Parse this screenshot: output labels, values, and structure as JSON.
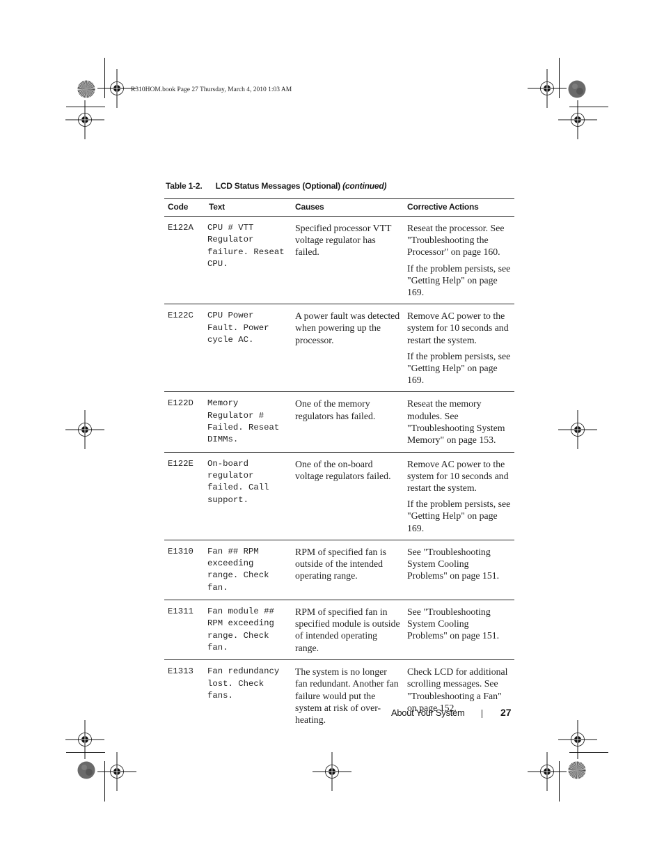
{
  "slug": "R310HOM.book  Page 27  Thursday, March 4, 2010  1:03 AM",
  "table": {
    "number": "Table 1-2.",
    "title": "LCD Status Messages (Optional)",
    "continued": "(continued)",
    "headers": [
      "Code",
      "Text",
      "Causes",
      "Corrective Actions"
    ],
    "rows": [
      {
        "code": "E122A",
        "text": "CPU # VTT Regulator failure. Reseat CPU.",
        "causes": "Specified processor VTT voltage regulator has failed.",
        "actions": [
          "Reseat the processor. See \"Troubleshooting the Processor\" on page 160.",
          "If the problem persists, see \"Getting Help\" on page 169."
        ]
      },
      {
        "code": "E122C",
        "text": "CPU Power Fault. Power cycle AC.",
        "causes": "A power fault was detected when powering up the processor.",
        "actions": [
          "Remove AC power to the system for 10 seconds and restart the system.",
          "If the problem persists, see \"Getting Help\" on page 169."
        ]
      },
      {
        "code": "E122D",
        "text": "Memory Regulator # Failed. Reseat DIMMs.",
        "causes": "One of the memory regulators has failed.",
        "actions": [
          "Reseat the memory modules. See \"Troubleshooting System Memory\" on page 153."
        ]
      },
      {
        "code": "E122E",
        "text": "On-board regulator failed. Call support.",
        "causes": "One of the on-board voltage regulators failed.",
        "actions": [
          "Remove AC power to the system for 10 seconds and restart the system.",
          "If the problem persists, see \"Getting Help\" on page 169."
        ]
      },
      {
        "code": "E1310",
        "text": "Fan ## RPM exceeding range. Check fan.",
        "causes": "RPM of specified fan is outside of the intended operating range.",
        "actions": [
          "See \"Troubleshooting System Cooling Problems\" on page 151."
        ]
      },
      {
        "code": "E1311",
        "text": "Fan module ## RPM exceeding range. Check fan.",
        "causes": "RPM of specified fan in specified module is outside of intended operating range.",
        "actions": [
          "See \"Troubleshooting System Cooling Problems\" on page 151."
        ]
      },
      {
        "code": "E1313",
        "text": "Fan redundancy lost. Check fans.",
        "causes": "The system is no longer fan redundant. Another fan failure would put the system at risk of over-heating.",
        "actions": [
          "Check LCD for additional scrolling messages. See \"Troubleshooting a Fan\" on page 152."
        ]
      }
    ]
  },
  "footer": {
    "section": "About Your System",
    "page": "27"
  }
}
